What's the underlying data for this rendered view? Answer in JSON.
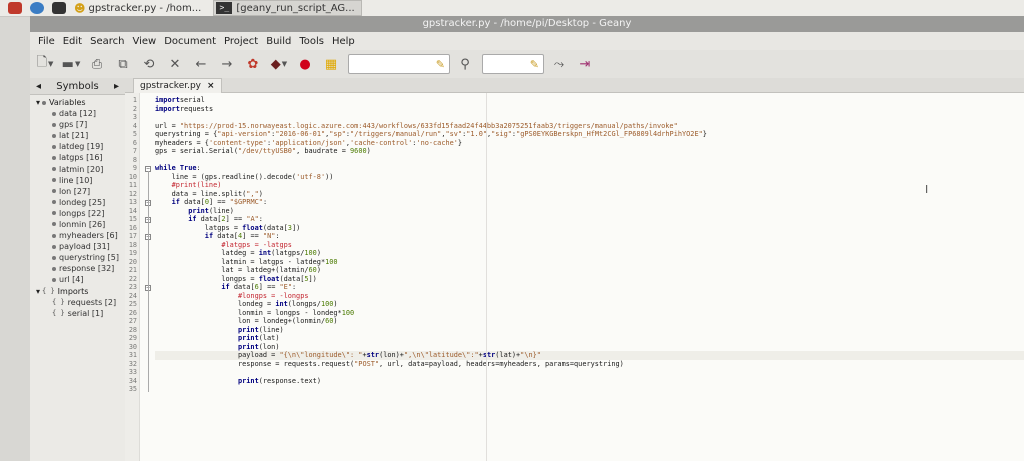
{
  "taskbar": {
    "tasks": [
      {
        "label": "gpstracker.py - /hom..."
      },
      {
        "label": "[geany_run_script_AG..."
      }
    ],
    "terminal_glyph": ">_"
  },
  "window": {
    "title": "gpstracker.py - /home/pi/Desktop - Geany"
  },
  "menu": [
    "File",
    "Edit",
    "Search",
    "View",
    "Document",
    "Project",
    "Build",
    "Tools",
    "Help"
  ],
  "sidebar": {
    "tab_label": "Symbols",
    "groups": [
      {
        "label": "Variables",
        "items": [
          "data [12]",
          "gps [7]",
          "lat [21]",
          "latdeg [19]",
          "latgps [16]",
          "latmin [20]",
          "line [10]",
          "lon [27]",
          "londeg [25]",
          "longps [22]",
          "lonmin [26]",
          "myheaders [6]",
          "payload [31]",
          "querystring [5]",
          "response [32]",
          "url [4]"
        ]
      },
      {
        "label": "Imports",
        "items": [
          "requests [2]",
          "serial [1]"
        ]
      }
    ]
  },
  "editor": {
    "tab_label": "gpstracker.py",
    "tab_close": "×",
    "lines": [
      [
        [
          "kw",
          "import"
        ],
        [
          "",
          "serial"
        ]
      ],
      [
        [
          "kw",
          "import"
        ],
        [
          "",
          "requests"
        ]
      ],
      [],
      [
        [
          "",
          "url = "
        ],
        [
          "str",
          "\"https://prod-15.norwayeast.logic.azure.com:443/workflows/633fd15faad24f44bb3a2075251faab3/triggers/manual/paths/invoke\""
        ]
      ],
      [
        [
          "",
          "querystring = {"
        ],
        [
          "str",
          "\"api-version\""
        ],
        [
          "",
          ":"
        ],
        [
          "str",
          "\"2016-06-01\""
        ],
        [
          "",
          ","
        ],
        [
          "str",
          "\"sp\""
        ],
        [
          "",
          ":"
        ],
        [
          "str",
          "\"/triggers/manual/run\""
        ],
        [
          "",
          ","
        ],
        [
          "str",
          "\"sv\""
        ],
        [
          "",
          ":"
        ],
        [
          "str",
          "\"1.0\""
        ],
        [
          "",
          ","
        ],
        [
          "str",
          "\"sig\""
        ],
        [
          "",
          ":"
        ],
        [
          "str",
          "\"gPS0EYKGBerskpn_HfMt2CGl_FP6809l4drhPihYO2E\""
        ],
        [
          "",
          "}"
        ]
      ],
      [
        [
          "",
          "myheaders = {"
        ],
        [
          "str",
          "'content-type'"
        ],
        [
          "",
          ":"
        ],
        [
          "str",
          "'application/json'"
        ],
        [
          "",
          ","
        ],
        [
          "str",
          "'cache-control'"
        ],
        [
          "",
          ":"
        ],
        [
          "str",
          "'no-cache'"
        ],
        [
          "",
          "}"
        ]
      ],
      [
        [
          "",
          "gps = serial.Serial("
        ],
        [
          "str",
          "\"/dev/ttyUSB0\""
        ],
        [
          "",
          ", baudrate = "
        ],
        [
          "num",
          "9600"
        ],
        [
          "",
          ")"
        ]
      ],
      [],
      [
        [
          "kw",
          "while"
        ],
        [
          "",
          " "
        ],
        [
          "kw",
          "True"
        ],
        [
          "",
          ":"
        ]
      ],
      [
        [
          "",
          "    line = (gps.readline().decode("
        ],
        [
          "str",
          "'utf-8'"
        ],
        [
          "",
          "))"
        ]
      ],
      [
        [
          "com",
          "    #print(line)"
        ]
      ],
      [
        [
          "",
          "    data = line.split("
        ],
        [
          "str",
          "\",\""
        ],
        [
          "",
          ")"
        ]
      ],
      [
        [
          "",
          "    "
        ],
        [
          "kw",
          "if"
        ],
        [
          "",
          " data["
        ],
        [
          "num",
          "0"
        ],
        [
          "",
          "] == "
        ],
        [
          "str",
          "\"$GPRMC\""
        ],
        [
          "",
          ":"
        ]
      ],
      [
        [
          "",
          "        "
        ],
        [
          "kw",
          "print"
        ],
        [
          "",
          "(line)"
        ]
      ],
      [
        [
          "",
          "        "
        ],
        [
          "kw",
          "if"
        ],
        [
          "",
          " data["
        ],
        [
          "num",
          "2"
        ],
        [
          "",
          "] == "
        ],
        [
          "str",
          "\"A\""
        ],
        [
          "",
          ":"
        ]
      ],
      [
        [
          "",
          "            latgps = "
        ],
        [
          "kw",
          "float"
        ],
        [
          "",
          "(data["
        ],
        [
          "num",
          "3"
        ],
        [
          "",
          "])"
        ]
      ],
      [
        [
          "",
          "            "
        ],
        [
          "kw",
          "if"
        ],
        [
          "",
          " data["
        ],
        [
          "num",
          "4"
        ],
        [
          "",
          "] == "
        ],
        [
          "str",
          "\"N\""
        ],
        [
          "",
          ":"
        ]
      ],
      [
        [
          "com",
          "                #latgps = -latgps"
        ]
      ],
      [
        [
          "",
          "                latdeg = "
        ],
        [
          "kw",
          "int"
        ],
        [
          "",
          "(latgps/"
        ],
        [
          "num",
          "100"
        ],
        [
          "",
          ")"
        ]
      ],
      [
        [
          "",
          "                latmin = latgps - latdeg*"
        ],
        [
          "num",
          "100"
        ]
      ],
      [
        [
          "",
          "                lat = latdeg+(latmin/"
        ],
        [
          "num",
          "60"
        ],
        [
          "",
          ")"
        ]
      ],
      [
        [
          "",
          "                longps = "
        ],
        [
          "kw",
          "float"
        ],
        [
          "",
          "(data["
        ],
        [
          "num",
          "5"
        ],
        [
          "",
          "])"
        ]
      ],
      [
        [
          "",
          "                "
        ],
        [
          "kw",
          "if"
        ],
        [
          "",
          " data["
        ],
        [
          "num",
          "6"
        ],
        [
          "",
          "] == "
        ],
        [
          "str",
          "\"E\""
        ],
        [
          "",
          ":"
        ]
      ],
      [
        [
          "com",
          "                    #longps = -longps"
        ]
      ],
      [
        [
          "",
          "                    londeg = "
        ],
        [
          "kw",
          "int"
        ],
        [
          "",
          "(longps/"
        ],
        [
          "num",
          "100"
        ],
        [
          "",
          ")"
        ]
      ],
      [
        [
          "",
          "                    lonmin = longps - londeg*"
        ],
        [
          "num",
          "100"
        ]
      ],
      [
        [
          "",
          "                    lon = londeg+(lonmin/"
        ],
        [
          "num",
          "60"
        ],
        [
          "",
          ")"
        ]
      ],
      [
        [
          "",
          "                    "
        ],
        [
          "kw",
          "print"
        ],
        [
          "",
          "(line)"
        ]
      ],
      [
        [
          "",
          "                    "
        ],
        [
          "kw",
          "print"
        ],
        [
          "",
          "(lat)"
        ]
      ],
      [
        [
          "",
          "                    "
        ],
        [
          "kw",
          "print"
        ],
        [
          "",
          "(lon)"
        ]
      ],
      [
        [
          "",
          "                    payload = "
        ],
        [
          "str",
          "\"{\\n\\\"longitude\\\": \""
        ],
        [
          "",
          "+"
        ],
        [
          "kw",
          "str"
        ],
        [
          "",
          "(lon)+"
        ],
        [
          "str",
          "\",\\n\\\"latitude\\\":\""
        ],
        [
          "",
          "+"
        ],
        [
          "kw",
          "str"
        ],
        [
          "",
          "(lat)+"
        ],
        [
          "str",
          "\"\\n}\""
        ]
      ],
      [
        [
          "",
          "                    response = requests.request("
        ],
        [
          "str",
          "\"POST\""
        ],
        [
          "",
          ", url, data=payload, headers=myheaders, params=querystring)"
        ]
      ],
      [],
      [
        [
          "",
          "                    "
        ],
        [
          "kw",
          "print"
        ],
        [
          "",
          "(response.text)"
        ]
      ],
      []
    ],
    "current_line": 31
  },
  "toolbar": {
    "search_icon": "magnifier-icon",
    "clear_icon": "broom-icon"
  }
}
